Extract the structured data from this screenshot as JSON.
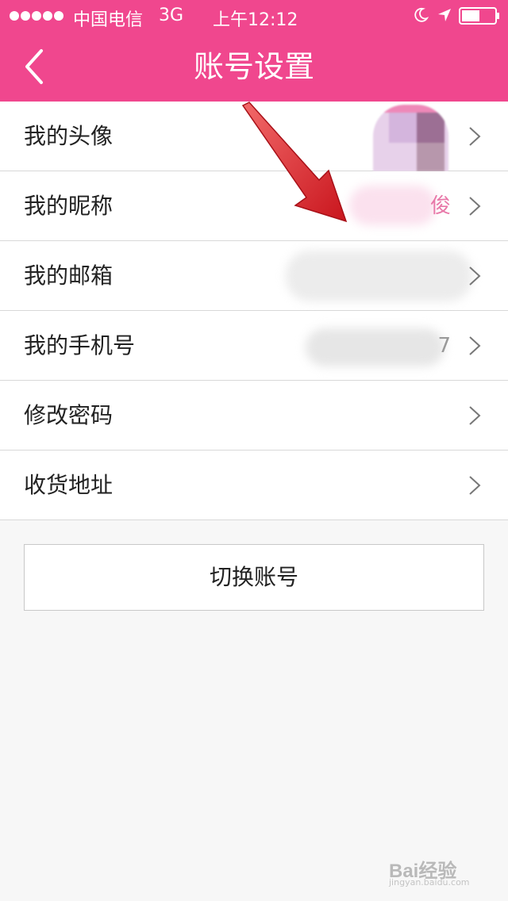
{
  "status_bar": {
    "carrier": "中国电信",
    "network": "3G",
    "time": "上午12:12"
  },
  "nav": {
    "title": "账号设置"
  },
  "menu": [
    {
      "label": "我的头像",
      "value": ""
    },
    {
      "label": "我的昵称",
      "value": "俊"
    },
    {
      "label": "我的邮箱",
      "value": ""
    },
    {
      "label": "我的手机号",
      "value": "7"
    },
    {
      "label": "修改密码",
      "value": ""
    },
    {
      "label": "收货地址",
      "value": ""
    }
  ],
  "switch_account_label": "切换账号",
  "watermark": {
    "logo": "Bai经验",
    "url": "jingyan.baidu.com"
  },
  "colors": {
    "brand_pink": "#f0478e",
    "arrow_red": "#e0262d"
  }
}
